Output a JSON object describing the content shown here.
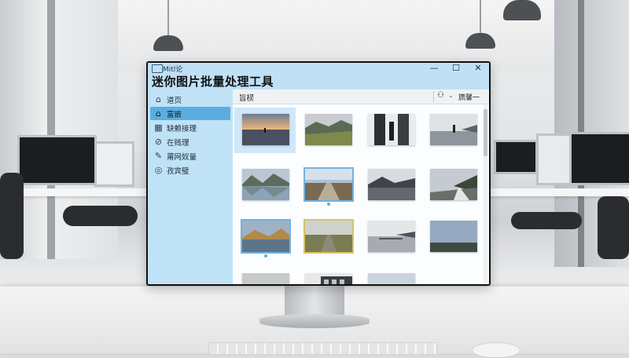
{
  "app": {
    "name": "Mitl论",
    "title": "迷你图片批量处理工具",
    "window_controls": [
      "—",
      "☐",
      "✕"
    ]
  },
  "sidebar": {
    "items": [
      {
        "label": "道页",
        "icon": "home-outline-icon",
        "active": false
      },
      {
        "label": "富嵌",
        "icon": "home-filled-icon",
        "active": true
      },
      {
        "label": "缺赖接理",
        "icon": "grid-icon",
        "active": false
      },
      {
        "label": "在贱理",
        "icon": "link-icon",
        "active": false
      },
      {
        "label": "莆网奴量",
        "icon": "pen-icon",
        "active": false
      },
      {
        "label": "孜宾璧",
        "icon": "target-icon",
        "active": false
      }
    ]
  },
  "toolbar": {
    "breadcrumb": "旨棂",
    "user_icon": "user-icon",
    "caret": "⌄",
    "label": "旒馨一"
  },
  "colors": {
    "titlebar": "#bfe0f5",
    "sidebar": "#bfe2f6",
    "active_item": "#5aaedf",
    "selection": "#cfe7f8"
  },
  "gallery": {
    "images": [
      {
        "subject": "sunset-lake-figure",
        "selected": true,
        "frame": "none"
      },
      {
        "subject": "mountain-grass-valley",
        "selected": false,
        "frame": "none"
      },
      {
        "subject": "corridor-mirror",
        "selected": false,
        "frame": "none"
      },
      {
        "subject": "figure-on-lake",
        "selected": false,
        "frame": "none"
      },
      {
        "subject": "mountain-lake-reflection",
        "selected": false,
        "frame": "none"
      },
      {
        "subject": "road-to-horizon",
        "selected": false,
        "frame": "blue"
      },
      {
        "subject": "grey-lake-mountains",
        "selected": false,
        "frame": "none"
      },
      {
        "subject": "hills-road",
        "selected": false,
        "frame": "none"
      },
      {
        "subject": "golden-mountain-lake",
        "selected": false,
        "frame": "blue"
      },
      {
        "subject": "road-grass-plain",
        "selected": false,
        "frame": "gold"
      },
      {
        "subject": "misty-water-pier",
        "selected": false,
        "frame": "none"
      },
      {
        "subject": "sky-landscape",
        "selected": false,
        "frame": "none"
      },
      {
        "subject": "bw-field",
        "selected": false,
        "frame": "none"
      },
      {
        "subject": "building-facade",
        "selected": false,
        "frame": "none"
      },
      {
        "subject": "pale-horizon",
        "selected": false,
        "frame": "none"
      }
    ]
  }
}
